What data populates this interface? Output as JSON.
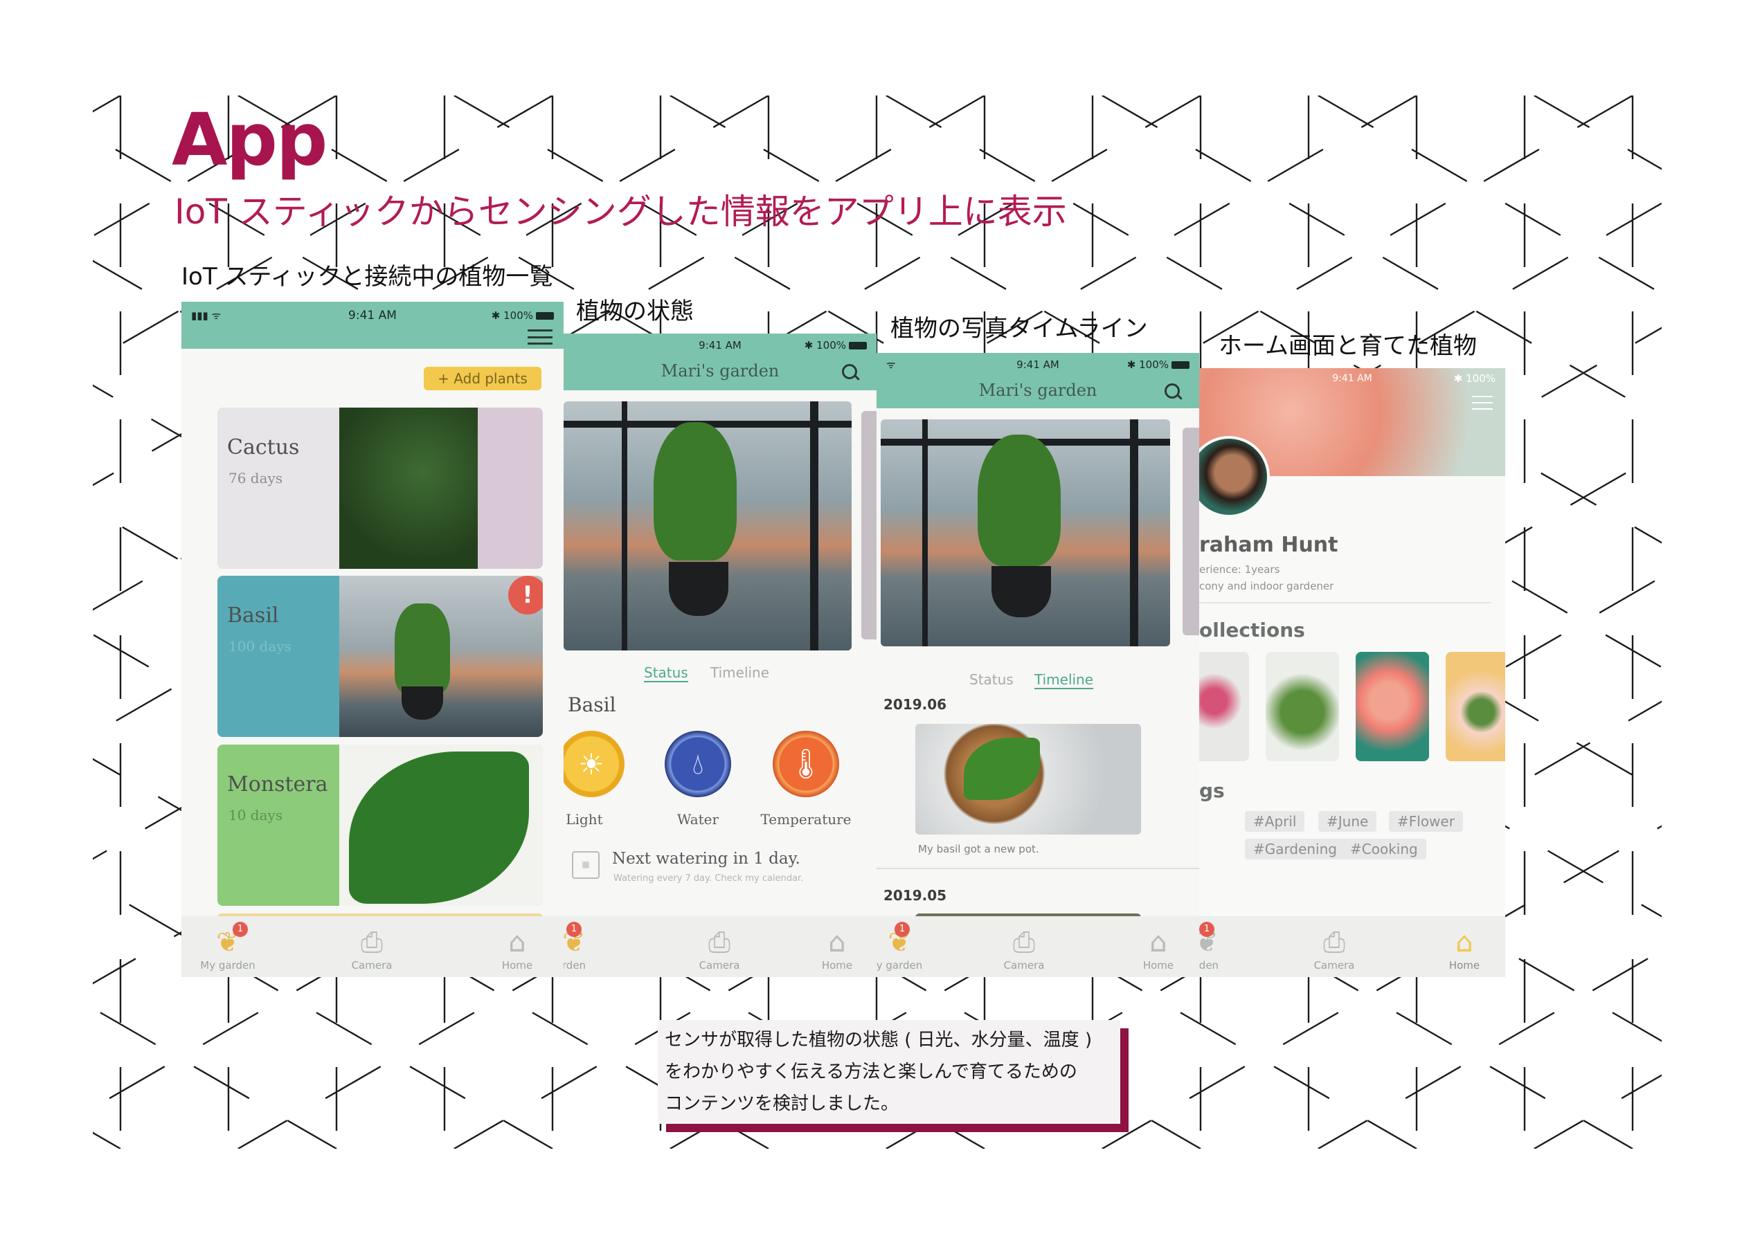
{
  "title": "App",
  "subtitle": "IoT スティックからセンシングした情報をアプリ上に表示",
  "captions": {
    "list": "IoT スティックと接続中の植物一覧",
    "status": "植物の状態",
    "timeline": "植物の写真タイムライン",
    "home": "ホーム画面と育てた植物"
  },
  "colors": {
    "brand": "#a8144e",
    "appbar": "#7cc3ad",
    "accent_yellow": "#f2c94c",
    "badge": "#e35b4e"
  },
  "common": {
    "time": "9:41 AM",
    "battery": "100%",
    "garden_title": "Mari's garden"
  },
  "tabs": {
    "my_garden": "My garden",
    "my_garden_clip": "y garden",
    "garden_clip": "rden",
    "camera": "Camera",
    "home": "Home",
    "badge": "1"
  },
  "screen1": {
    "add_plants": "+ Add plants",
    "plants": [
      {
        "name": "Cactus",
        "days": "76 days"
      },
      {
        "name": "Basil",
        "days": "100 days",
        "alert": "!"
      },
      {
        "name": "Monstera",
        "days": "10 days"
      }
    ]
  },
  "screen2": {
    "tabs": {
      "status": "Status",
      "timeline": "Timeline"
    },
    "plant": "Basil",
    "sensors": [
      {
        "label": "Light",
        "icon": "sun-icon"
      },
      {
        "label": "Water",
        "icon": "drop-icon"
      },
      {
        "label": "Temperature",
        "icon": "thermometer-icon"
      }
    ],
    "next_watering": "Next watering in  1  day.",
    "watering_note": "Watering every 7 day. Check my calendar."
  },
  "screen3": {
    "entries": [
      {
        "date": "2019.06",
        "caption": "My basil got  a new pot."
      },
      {
        "date": "2019.05"
      }
    ]
  },
  "screen4": {
    "name": "raham Hunt",
    "experience": "erience:  1years",
    "type": "cony and indoor gardener",
    "collections_title": "ollections",
    "tags_title": "gs",
    "tags": [
      "#April",
      "#June",
      "#Flower",
      "#Gardening",
      "#Cooking"
    ]
  },
  "note": {
    "lines": [
      "センサが取得した植物の状態 ( 日光、水分量、温度 )",
      "をわかりやすく伝える方法と楽しんで育てるための",
      "コンテンツを検討しました。"
    ]
  }
}
